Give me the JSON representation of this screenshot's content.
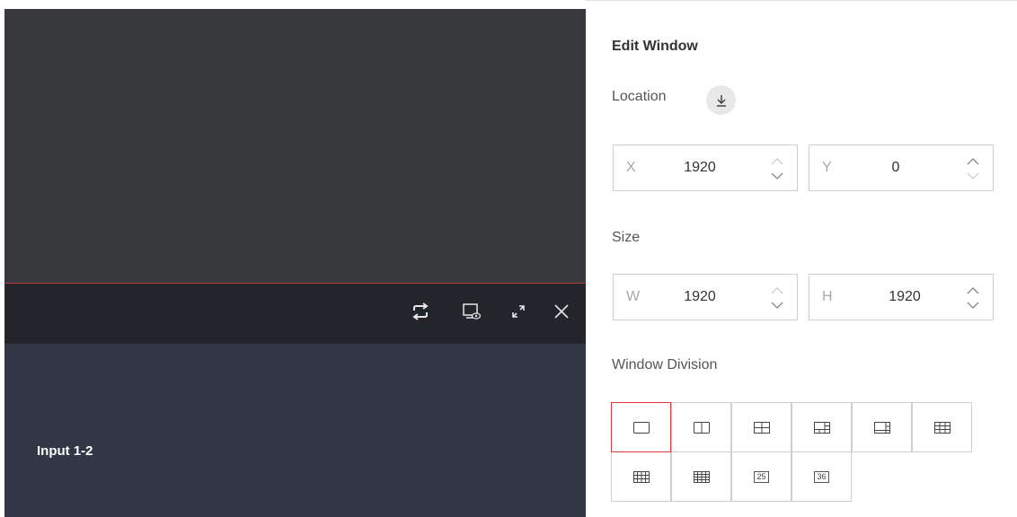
{
  "preview": {
    "input_label": "Input 1-2",
    "toolbar_icons": [
      "repeat-icon",
      "monitor-preview-icon",
      "expand-icon",
      "close-icon"
    ]
  },
  "panel": {
    "title": "Edit Window",
    "location_label": "Location",
    "location_icon": "download-icon",
    "x": {
      "prefix": "X",
      "value": "1920"
    },
    "y": {
      "prefix": "Y",
      "value": "0"
    },
    "size_label": "Size",
    "w": {
      "prefix": "W",
      "value": "1920"
    },
    "h": {
      "prefix": "H",
      "value": "1920"
    },
    "division_label": "Window Division",
    "divisions": [
      {
        "name": "division-1",
        "icon": "single-window-icon",
        "selected": true
      },
      {
        "name": "division-2",
        "icon": "split-2-icon",
        "selected": false
      },
      {
        "name": "division-4",
        "icon": "split-4-icon",
        "selected": false
      },
      {
        "name": "division-6a",
        "icon": "split-6a-icon",
        "selected": false
      },
      {
        "name": "division-6b",
        "icon": "split-6b-icon",
        "selected": false
      },
      {
        "name": "division-9",
        "icon": "split-9-icon",
        "selected": false
      },
      {
        "name": "division-12",
        "icon": "split-12-icon",
        "selected": false
      },
      {
        "name": "division-16",
        "icon": "split-16-icon",
        "selected": false
      },
      {
        "name": "division-25",
        "label": "25",
        "selected": false
      },
      {
        "name": "division-36",
        "label": "36",
        "selected": false
      }
    ]
  },
  "colors": {
    "accent_border": "#d9363e",
    "toolbar_bg": "#23252b",
    "preview_top": "#38393d",
    "preview_bottom": "#323746"
  }
}
